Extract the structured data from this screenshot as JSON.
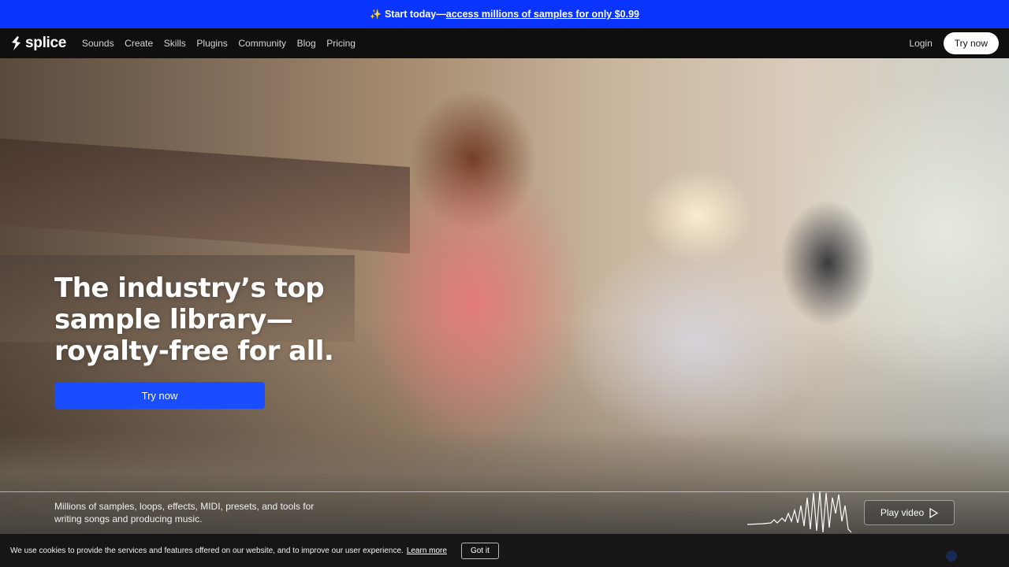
{
  "promo": {
    "icon": "sparkle-icon",
    "prefix": "Start today—",
    "link_text": "access millions of samples for only $0.99",
    "background": "#0a34ff"
  },
  "nav": {
    "logo_text": "splice",
    "links": [
      "Sounds",
      "Create",
      "Skills",
      "Plugins",
      "Community",
      "Blog",
      "Pricing"
    ],
    "login": "Login",
    "try_now": "Try now"
  },
  "hero": {
    "headline_lines": [
      "The industry’s top",
      "sample library—",
      "royalty-free for all."
    ],
    "cta": "Try now",
    "cta_color": "#1a4dff",
    "description": "Millions of samples, loops, effects, MIDI, presets, and tools for writing songs and producing music.",
    "play_video": "Play video"
  },
  "cookie": {
    "text": "We use cookies to provide the services and features offered on our website, and to improve our user experience.",
    "learn_more": "Learn more",
    "got_it": "Got it"
  }
}
